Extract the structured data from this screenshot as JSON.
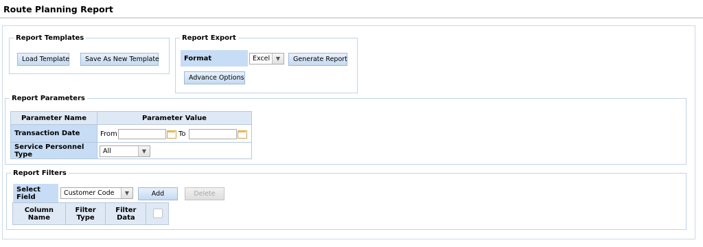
{
  "page": {
    "title": "Route Planning Report"
  },
  "templates": {
    "legend": "Report Templates",
    "load_label": "Load Template",
    "save_new_label": "Save As New Template"
  },
  "export": {
    "legend": "Report Export",
    "format_label": "Format",
    "format_value": "Excel",
    "generate_label": "Generate Report",
    "advance_label": "Advance Options"
  },
  "parameters": {
    "legend": "Report Parameters",
    "col_name": "Parameter Name",
    "col_value": "Parameter Value",
    "transaction_date_label": "Transaction Date",
    "from_label": "From",
    "to_label": "To",
    "from_value": "",
    "to_value": "",
    "personnel_type_label": "Service Personnel Type",
    "personnel_type_value": "All"
  },
  "filters": {
    "legend": "Report Filters",
    "select_field_label": "Select Field",
    "select_field_value": "Customer Code",
    "add_label": "Add",
    "delete_label": "Delete",
    "columns": [
      "Column Name",
      "Filter Type",
      "Filter Data"
    ]
  },
  "colors": {
    "accent_blue": "#c7dcf5",
    "border_blue": "#c0d3e8"
  },
  "icons": {
    "calendar": "calendar-icon",
    "dropdown": "chevron-down-icon"
  }
}
